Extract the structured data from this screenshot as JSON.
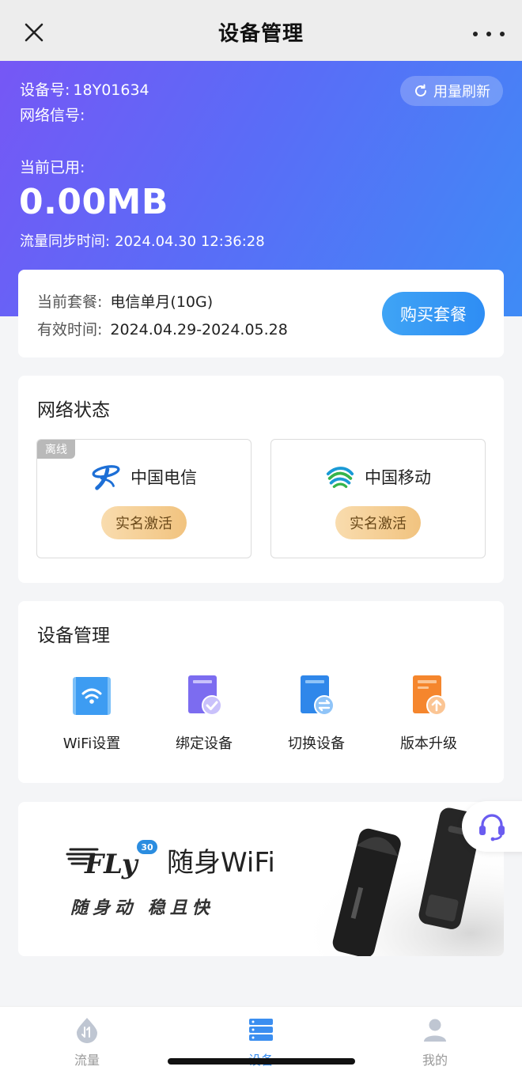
{
  "nav": {
    "title": "设备管理"
  },
  "hero": {
    "device_no_label": "设备号:",
    "device_no": "18Y01634",
    "signal_label": "网络信号:",
    "signal_value": "",
    "used_label": "当前已用:",
    "used_value": "0.00MB",
    "sync_label": "流量同步时间:",
    "sync_time": "2024.04.30 12:36:28",
    "refresh_label": "用量刷新"
  },
  "plan": {
    "current_label": "当前套餐:",
    "current_value": "电信单月(10G)",
    "valid_label": "有效时间:",
    "valid_value": "2024.04.29-2024.05.28",
    "buy_label": "购买套餐"
  },
  "network": {
    "title": "网络状态",
    "carriers": [
      {
        "name": "中国电信",
        "tag": "离线",
        "action": "实名激活",
        "logo": "china-telecom-logo"
      },
      {
        "name": "中国移动",
        "action": "实名激活",
        "logo": "china-mobile-logo"
      }
    ]
  },
  "device_mgmt": {
    "title": "设备管理",
    "items": [
      {
        "label": "WiFi设置",
        "icon": "wifi-settings-icon"
      },
      {
        "label": "绑定设备",
        "icon": "bind-device-icon"
      },
      {
        "label": "切换设备",
        "icon": "switch-device-icon"
      },
      {
        "label": "版本升级",
        "icon": "upgrade-icon"
      }
    ]
  },
  "banner": {
    "brand": "FLy",
    "badge": "30",
    "product": "随身WiFi",
    "slogan": "随身动 稳且快"
  },
  "tabs": [
    {
      "label": "流量",
      "icon": "traffic-icon"
    },
    {
      "label": "设备",
      "icon": "device-icon",
      "active": true
    },
    {
      "label": "我的",
      "icon": "profile-icon"
    }
  ],
  "colors": {
    "accent": "#3b8ef0",
    "hero_start": "#7657f5",
    "hero_end": "#3f8bf6",
    "activate": "#f1c37f"
  }
}
